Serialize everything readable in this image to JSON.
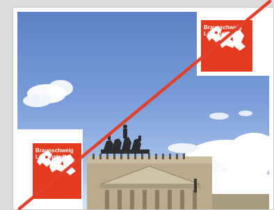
{
  "logos": [
    {
      "line1": "Braunschweig",
      "line2": "Löwenstadt"
    },
    {
      "line1": "Braunschweig",
      "line2": "Löwenstadt"
    }
  ],
  "colors": {
    "brand_red": "#e43a1f",
    "slash_red": "#e2402b",
    "sky": "#6f93d3"
  },
  "icons": [
    "lion-emblem-icon",
    "prohibited-slash-icon"
  ]
}
